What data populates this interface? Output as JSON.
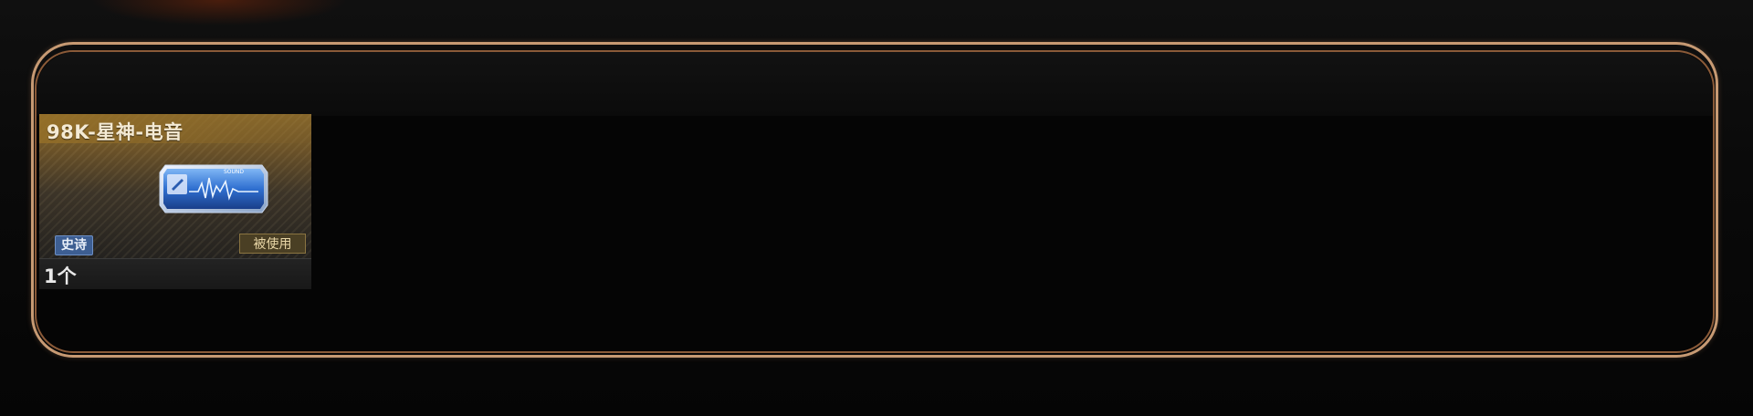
{
  "inventory": {
    "items": [
      {
        "name": "98K-星神-电音",
        "icon": "sound-card-icon",
        "icon_text": "SOUND",
        "rarity": "史诗",
        "status": "被使用",
        "quantity": "1个"
      }
    ]
  },
  "colors": {
    "frame_outer": "#c79a73",
    "frame_inner": "#8a5a38",
    "card_gold": "#8a6a2c",
    "rarity_blue": "#3d5e92",
    "status_gold": "#4a3f24"
  }
}
